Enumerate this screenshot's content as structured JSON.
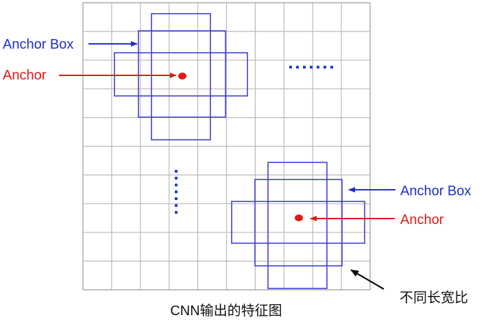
{
  "labels": {
    "anchor_box_left": "Anchor Box",
    "anchor_left": "Anchor",
    "anchor_box_right": "Anchor Box",
    "anchor_right": "Anchor",
    "aspect_ratios": "不同长宽比",
    "caption": "CNN输出的特征图"
  },
  "colors": {
    "grid_line": "#b9b9b9",
    "grid_border": "#9a9a9a",
    "box_stroke": "#3f3fd4",
    "anchor_point": "#e01818",
    "anchor_box_text": "#1f2fc8",
    "anchor_text": "#e01818",
    "ellipsis_dots": "#2040d0",
    "black_text": "#111111"
  },
  "grid": {
    "rows": 10,
    "cols": 10
  },
  "icons": {
    "horizontal_ellipsis": "horizontal-dots",
    "vertical_ellipsis": "vertical-dots"
  }
}
